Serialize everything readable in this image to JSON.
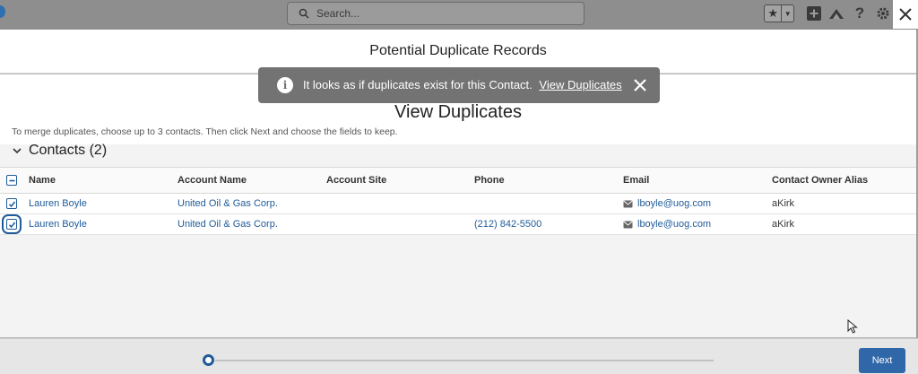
{
  "header": {
    "search_placeholder": "Search...",
    "icons": [
      "favorites-star-icon",
      "favorites-dropdown-icon",
      "global-actions-plus-icon",
      "trailhead-icon",
      "help-icon",
      "setup-gear-icon",
      "close-icon"
    ]
  },
  "modal": {
    "title": "Potential Duplicate Records",
    "heading": "View Duplicates",
    "instructions": "To merge duplicates, choose up to 3 contacts. Then click Next and choose the fields to keep.",
    "section_label": "Contacts (2)"
  },
  "toast": {
    "message": "It looks as if duplicates exist for this Contact.",
    "link_label": "View Duplicates"
  },
  "table": {
    "columns": [
      "Name",
      "Account Name",
      "Account Site",
      "Phone",
      "Email",
      "Contact Owner Alias"
    ],
    "rows": [
      {
        "name": "Lauren Boyle",
        "account": "United Oil & Gas Corp.",
        "site": "",
        "phone": "",
        "email": "lboyle@uog.com",
        "owner": "aKirk",
        "checked": true
      },
      {
        "name": "Lauren Boyle",
        "account": "United Oil & Gas Corp.",
        "site": "",
        "phone": "(212) 842-5500",
        "email": "lboyle@uog.com",
        "owner": "aKirk",
        "checked": true
      }
    ]
  },
  "footer": {
    "next_label": "Next"
  },
  "colors": {
    "link": "#1f5b9a",
    "brand_button": "#2f67a8",
    "toast_bg": "#737373"
  }
}
